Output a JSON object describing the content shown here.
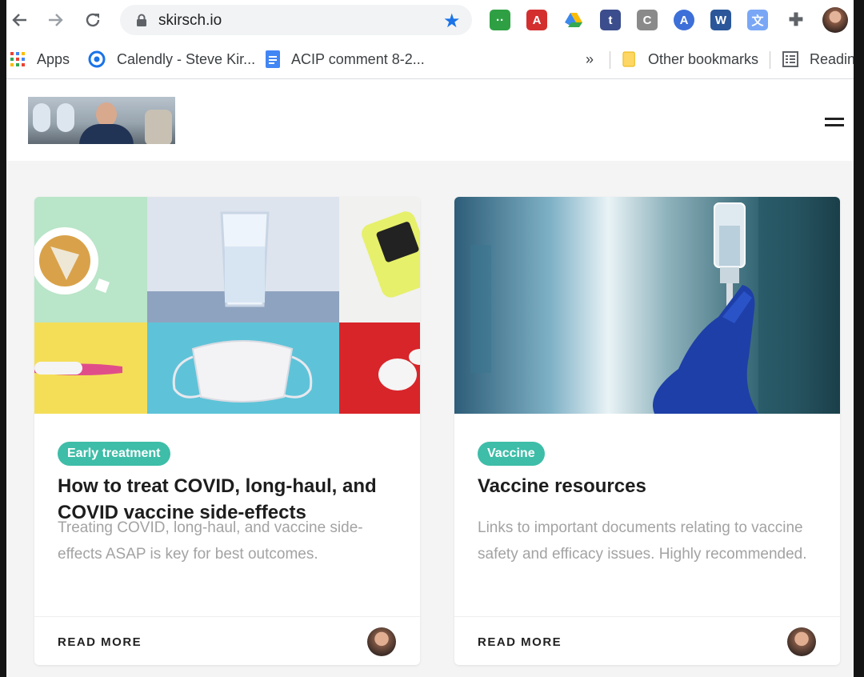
{
  "browser": {
    "url": "skirsch.io",
    "bookmarks": [
      {
        "label": "Apps",
        "icon": "apps-grid-icon"
      },
      {
        "label": "Calendly - Steve Kir...",
        "icon": "calendly-icon"
      },
      {
        "label": "ACIP comment 8-2...",
        "icon": "google-docs-icon"
      }
    ],
    "overflow_label": "»",
    "other_bookmarks": "Other bookmarks",
    "reading_list": "Readin",
    "extensions": [
      "roboform-icon",
      "acrobat-icon",
      "google-drive-icon",
      "tumblr-icon",
      "extension-c-icon",
      "extension-a-icon",
      "word-icon",
      "translate-icon",
      "puzzle-icon"
    ],
    "colors": {
      "accent": "#1a73e8"
    }
  },
  "site": {
    "logo_alt": "Steve Kirsch photo"
  },
  "cards": [
    {
      "tag": "Early treatment",
      "title": "How to treat COVID, long-haul, and COVID vaccine side-effects",
      "excerpt": "Treating COVID, long-haul, and vaccine side-effects ASAP is key for best outcomes.",
      "read_more": "READ MORE"
    },
    {
      "tag": "Vaccine",
      "title": "Vaccine resources",
      "excerpt": "Links to important documents relating to vaccine safety and efficacy issues. Highly recommended.",
      "read_more": "READ MORE"
    }
  ],
  "colors": {
    "tag_bg": "#3ebda8",
    "excerpt": "#a3a3a3",
    "title": "#1d1d1d"
  }
}
